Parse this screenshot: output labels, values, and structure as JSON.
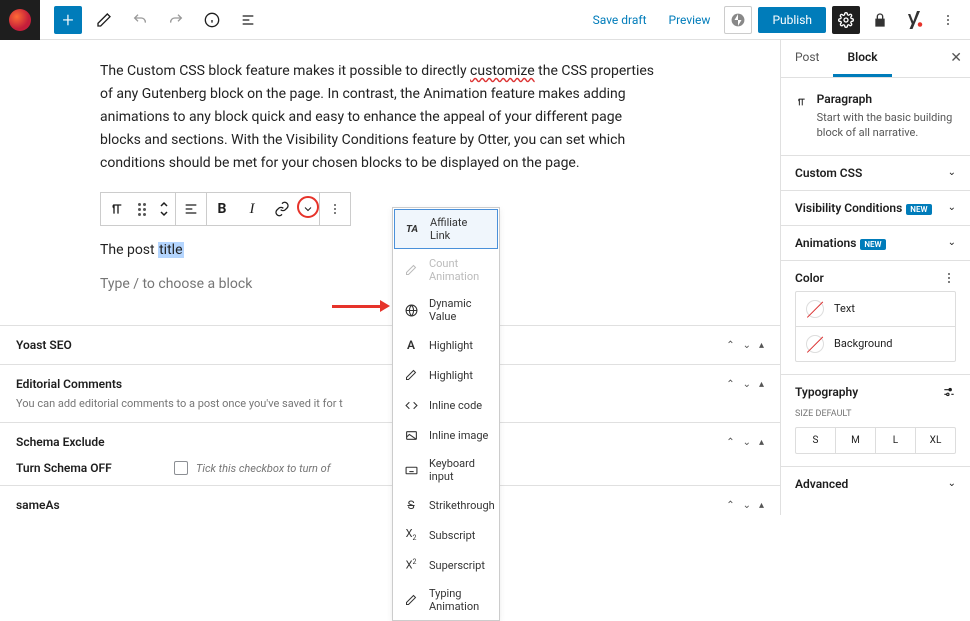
{
  "topbar": {
    "save_draft": "Save draft",
    "preview": "Preview",
    "publish": "Publish"
  },
  "content": {
    "paragraph_before": "The Custom CSS block feature makes it possible to directly ",
    "underlined": "customize",
    "paragraph_after": " the CSS properties of any Gutenberg block on the page. In contrast, the Animation feature makes adding animations to any block quick and easy to enhance the appeal of your different page blocks and sections. With the Visibility Conditions feature by Otter, you can set which conditions should be met for your chosen blocks to be displayed on the page.",
    "post_line_before": "The post ",
    "post_line_highlight": "title",
    "placeholder": "Type / to choose a block"
  },
  "dropdown": {
    "items": [
      {
        "icon": "TA",
        "label": "Affiliate Link",
        "highlighted": true
      },
      {
        "icon": "pen",
        "label": "Count Animation",
        "disabled": true
      },
      {
        "icon": "globe",
        "label": "Dynamic Value"
      },
      {
        "icon": "A",
        "label": "Highlight"
      },
      {
        "icon": "pen",
        "label": "Highlight"
      },
      {
        "icon": "code",
        "label": "Inline code"
      },
      {
        "icon": "image",
        "label": "Inline image"
      },
      {
        "icon": "keyboard",
        "label": "Keyboard input"
      },
      {
        "icon": "strike",
        "label": "Strikethrough"
      },
      {
        "icon": "sub",
        "label": "Subscript"
      },
      {
        "icon": "sup",
        "label": "Superscript"
      },
      {
        "icon": "pen",
        "label": "Typing Animation"
      }
    ]
  },
  "panels": {
    "yoast": "Yoast SEO",
    "editorial": "Editorial Comments",
    "editorial_desc": "You can add editorial comments to a post once you've saved it for t",
    "schema": "Schema Exclude",
    "schema_toggle": "Turn Schema OFF",
    "schema_hint": "Tick this checkbox to turn of",
    "sameas": "sameAs"
  },
  "sidebar": {
    "tabs": {
      "post": "Post",
      "block": "Block"
    },
    "block_name": "Paragraph",
    "block_desc": "Start with the basic building block of all narrative.",
    "panels": {
      "custom_css": "Custom CSS",
      "visibility": "Visibility Conditions",
      "animations": "Animations",
      "color": "Color",
      "typography": "Typography",
      "advanced": "Advanced"
    },
    "badge_new": "NEW",
    "color_items": {
      "text": "Text",
      "background": "Background"
    },
    "size_label": "SIZE",
    "size_default": "DEFAULT",
    "sizes": [
      "S",
      "M",
      "L",
      "XL"
    ]
  }
}
